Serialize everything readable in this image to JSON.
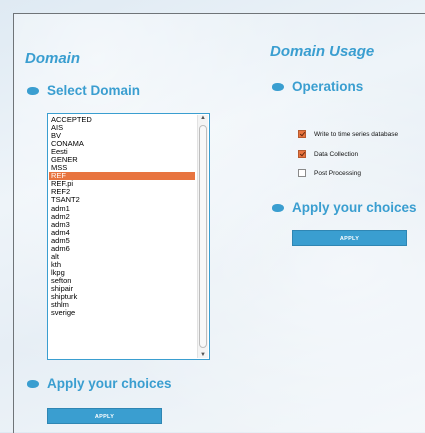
{
  "domain_panel": {
    "title": "Domain",
    "select_heading": "Select Domain",
    "domains": [
      "ACCEPTED",
      "AIS",
      "BV",
      "CONAMA",
      "Eesti",
      "GENER",
      "MSS",
      "REF",
      "REF.pi",
      "REF2",
      "TSANT2",
      "adm1",
      "adm2",
      "adm3",
      "adm4",
      "adm5",
      "adm6",
      "alt",
      "kth",
      "lkpg",
      "sefton",
      "shipair",
      "shipturk",
      "sthlm",
      "sverige"
    ],
    "selected": "REF",
    "apply_heading": "Apply your choices",
    "apply_button": "APPLY"
  },
  "usage_panel": {
    "title": "Domain Usage",
    "operations_heading": "Operations",
    "operations": [
      {
        "label": "Write to time series database",
        "checked": true
      },
      {
        "label": "Data Collection",
        "checked": true
      },
      {
        "label": "Post Processing",
        "checked": false
      }
    ],
    "apply_heading": "Apply your choices",
    "apply_button": "APPLY"
  },
  "colors": {
    "accent": "#3a9ed0",
    "selection": "#e8743f"
  }
}
